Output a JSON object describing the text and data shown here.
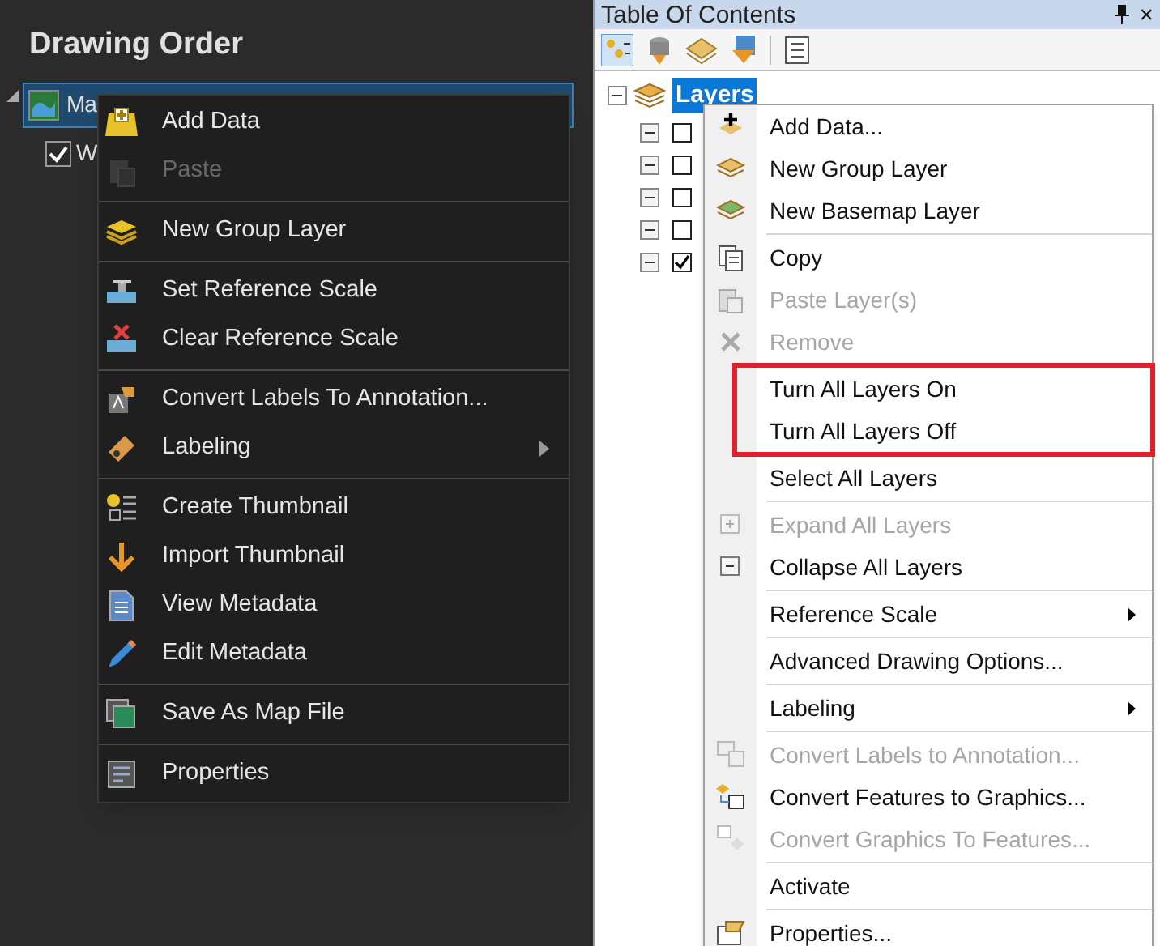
{
  "drawing_order": {
    "title": "Drawing Order",
    "tree": [
      {
        "label": "Ma",
        "selected": true,
        "expanded": true,
        "children": [
          {
            "label": "W",
            "checked": true
          }
        ]
      }
    ],
    "context_menu": [
      {
        "kind": "item",
        "label": "Add Data",
        "disabled": false
      },
      {
        "kind": "item",
        "label": "Paste",
        "disabled": true
      },
      {
        "kind": "separator"
      },
      {
        "kind": "item",
        "label": "New Group Layer",
        "disabled": false
      },
      {
        "kind": "separator"
      },
      {
        "kind": "item",
        "label": "Set Reference Scale",
        "disabled": false
      },
      {
        "kind": "item",
        "label": "Clear Reference Scale",
        "disabled": false
      },
      {
        "kind": "separator"
      },
      {
        "kind": "item",
        "label": "Convert Labels To Annotation...",
        "disabled": false
      },
      {
        "kind": "submenu",
        "label": "Labeling",
        "disabled": false
      },
      {
        "kind": "separator"
      },
      {
        "kind": "item",
        "label": "Create Thumbnail",
        "disabled": false
      },
      {
        "kind": "item",
        "label": "Import Thumbnail",
        "disabled": false
      },
      {
        "kind": "item",
        "label": "View Metadata",
        "disabled": false
      },
      {
        "kind": "item",
        "label": "Edit Metadata",
        "disabled": false
      },
      {
        "kind": "separator"
      },
      {
        "kind": "item",
        "label": "Save As Map File",
        "disabled": false
      },
      {
        "kind": "separator"
      },
      {
        "kind": "item",
        "label": "Properties",
        "disabled": false
      }
    ]
  },
  "table_of_contents": {
    "title": "Table Of Contents",
    "close": "×",
    "tree": {
      "label": "Layers",
      "selected": true,
      "expanded": true,
      "children": [
        {
          "expanded": true,
          "checked": false
        },
        {
          "expanded": true,
          "checked": false
        },
        {
          "expanded": true,
          "checked": false
        },
        {
          "expanded": true,
          "checked": false
        },
        {
          "expanded": true,
          "checked": true
        }
      ]
    },
    "context_menu": [
      {
        "kind": "item",
        "label": "Add Data...",
        "disabled": false,
        "highlighted": false
      },
      {
        "kind": "item",
        "label": "New Group Layer",
        "disabled": false,
        "highlighted": false
      },
      {
        "kind": "item",
        "label": "New Basemap Layer",
        "disabled": false,
        "highlighted": false
      },
      {
        "kind": "separator"
      },
      {
        "kind": "item",
        "label": "Copy",
        "disabled": false,
        "highlighted": false
      },
      {
        "kind": "item",
        "label": "Paste Layer(s)",
        "disabled": true,
        "highlighted": false
      },
      {
        "kind": "item",
        "label": "Remove",
        "disabled": true,
        "highlighted": false
      },
      {
        "kind": "item",
        "label": "Turn All Layers On",
        "disabled": false,
        "highlighted": true
      },
      {
        "kind": "item",
        "label": "Turn All Layers Off",
        "disabled": false,
        "highlighted": true
      },
      {
        "kind": "item",
        "label": "Select All Layers",
        "disabled": false,
        "highlighted": false
      },
      {
        "kind": "separator"
      },
      {
        "kind": "item",
        "label": "Expand All Layers",
        "disabled": true,
        "highlighted": false
      },
      {
        "kind": "item",
        "label": "Collapse All Layers",
        "disabled": false,
        "highlighted": false
      },
      {
        "kind": "separator"
      },
      {
        "kind": "submenu",
        "label": "Reference Scale",
        "disabled": false,
        "highlighted": false
      },
      {
        "kind": "separator"
      },
      {
        "kind": "item",
        "label": "Advanced Drawing Options...",
        "disabled": false,
        "highlighted": false
      },
      {
        "kind": "separator"
      },
      {
        "kind": "submenu",
        "label": "Labeling",
        "disabled": false,
        "highlighted": false
      },
      {
        "kind": "separator"
      },
      {
        "kind": "item",
        "label": "Convert Labels to Annotation...",
        "disabled": true,
        "highlighted": false
      },
      {
        "kind": "item",
        "label": "Convert Features to Graphics...",
        "disabled": false,
        "highlighted": false
      },
      {
        "kind": "item",
        "label": "Convert Graphics To Features...",
        "disabled": true,
        "highlighted": false
      },
      {
        "kind": "separator"
      },
      {
        "kind": "item",
        "label": "Activate",
        "disabled": false,
        "highlighted": false
      },
      {
        "kind": "separator"
      },
      {
        "kind": "item",
        "label": "Properties...",
        "disabled": false,
        "highlighted": false
      }
    ]
  }
}
